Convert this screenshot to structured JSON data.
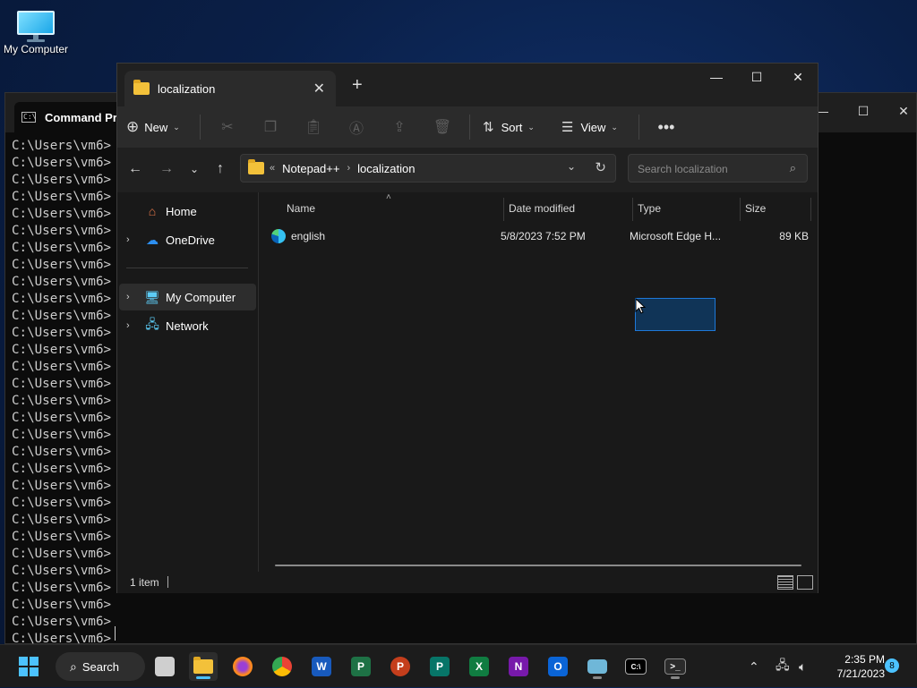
{
  "desktop": {
    "icon_label": "My Computer"
  },
  "cmd": {
    "title": "Command Pro",
    "prompt": "C:\\Users\\vm6>",
    "line_count": 30
  },
  "explorer": {
    "tab_title": "localization",
    "toolbar": {
      "new_label": "New",
      "sort_label": "Sort",
      "view_label": "View"
    },
    "address": {
      "crumb_prefix": "«",
      "crumbs": [
        "Notepad++",
        "localization"
      ]
    },
    "search": {
      "placeholder": "Search localization"
    },
    "nav": {
      "items": [
        {
          "label": "Home"
        },
        {
          "label": "OneDrive"
        },
        {
          "label": "My Computer"
        },
        {
          "label": "Network"
        }
      ]
    },
    "columns": {
      "name": "Name",
      "date": "Date modified",
      "type": "Type",
      "size": "Size"
    },
    "files": [
      {
        "name": "english",
        "date": "5/8/2023 7:52 PM",
        "type": "Microsoft Edge H...",
        "size": "89 KB"
      }
    ],
    "status": {
      "count": "1 item"
    }
  },
  "taskbar": {
    "search_label": "Search",
    "time": "2:35 PM",
    "date": "7/21/2023",
    "notifications": "8"
  },
  "colors": {
    "accent": "#4cc2ff",
    "selection": "#1e78d8"
  }
}
